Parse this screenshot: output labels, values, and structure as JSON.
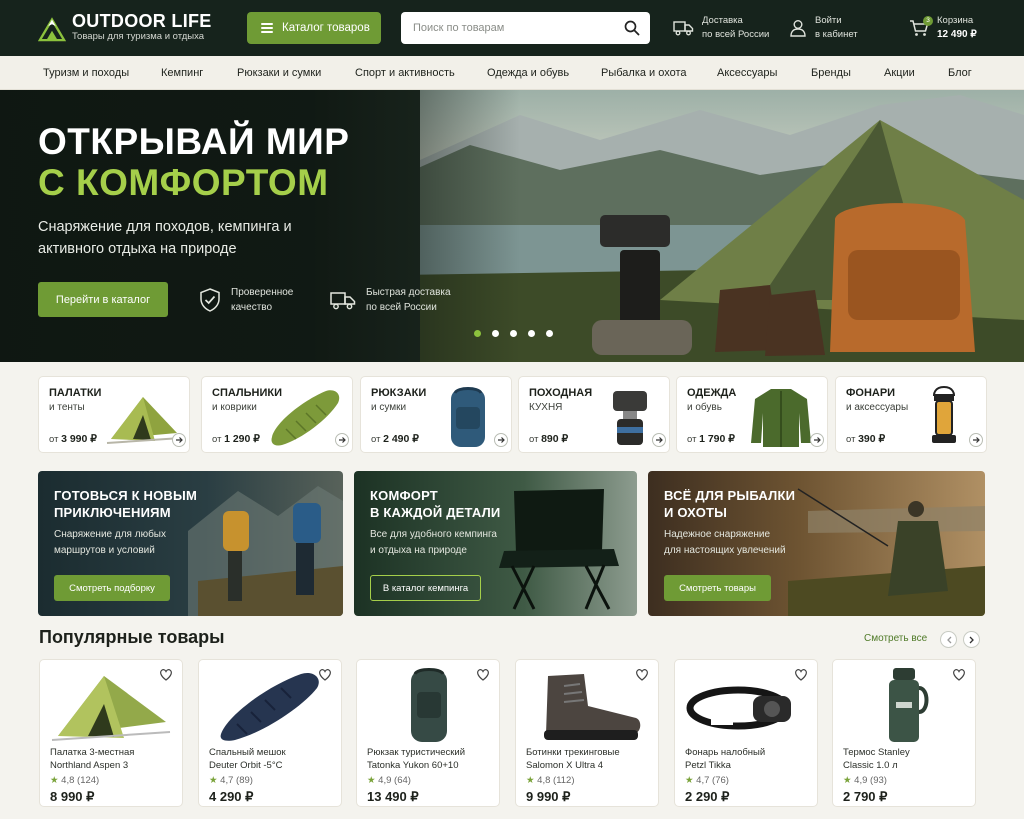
{
  "header": {
    "logo_title": "OUTDOOR LIFE",
    "logo_sub": "Товары для туризма и отдыха",
    "catalog_button": "Каталог товаров",
    "search_placeholder": "Поиск по товарам",
    "delivery_line1": "Доставка",
    "delivery_line2": "по всей России",
    "login_line1": "Войти",
    "login_line2": "в кабинет",
    "cart_label": "Корзина",
    "cart_total": "12 490 ₽",
    "cart_count": "3"
  },
  "nav": [
    {
      "label": "Туризм и походы"
    },
    {
      "label": "Кемпинг"
    },
    {
      "label": "Рюкзаки и сумки"
    },
    {
      "label": "Спорт и активность"
    },
    {
      "label": "Одежда и обувь"
    },
    {
      "label": "Рыбалка и охота"
    },
    {
      "label": "Аксессуары"
    },
    {
      "label": "Бренды"
    },
    {
      "label": "Акции"
    },
    {
      "label": "Блог"
    }
  ],
  "hero": {
    "title_line1": "ОТКРЫВАЙ МИР",
    "title_line2": "С КОМФОРТОМ",
    "subtitle": "Снаряжение для походов, кемпинга и активного отдыха на природе",
    "cta": "Перейти в каталог",
    "feature1": "Проверенное качество",
    "feature2": "Быстрая доставка по всей России",
    "slides_total": 5,
    "slide_active": 1
  },
  "categories": [
    {
      "title": "ПАЛАТКИ",
      "sub": "и тенты",
      "price_prefix": "от",
      "price": "3 990 ₽",
      "icon": "tent-icon"
    },
    {
      "title": "СПАЛЬНИКИ",
      "sub": "и коврики",
      "price_prefix": "от",
      "price": "1 290 ₽",
      "icon": "sleeping-bag-icon"
    },
    {
      "title": "РЮКЗАКИ",
      "sub": "и сумки",
      "price_prefix": "от",
      "price": "2 490 ₽",
      "icon": "backpack-icon"
    },
    {
      "title": "ПОХОДНАЯ",
      "sub": "КУХНЯ",
      "price_prefix": "от",
      "price": "890 ₽",
      "icon": "camp-stove-icon"
    },
    {
      "title": "ОДЕЖДА",
      "sub": "и обувь",
      "price_prefix": "от",
      "price": "1 790 ₽",
      "icon": "jacket-icon"
    },
    {
      "title": "ФОНАРИ",
      "sub": "и аксессуары",
      "price_prefix": "от",
      "price": "390 ₽",
      "icon": "lantern-icon"
    }
  ],
  "promos": [
    {
      "title_line1": "ГОТОВЬСЯ К НОВЫМ",
      "title_line2": "ПРИКЛЮЧЕНИЯМ",
      "text_line1": "Снаряжение для любых",
      "text_line2": "маршрутов и условий",
      "button": "Смотреть подборку"
    },
    {
      "title_line1": "КОМФОРТ",
      "title_line2": "В КАЖДОЙ ДЕТАЛИ",
      "text_line1": "Все для удобного кемпинга",
      "text_line2": "и отдыха на природе",
      "button": "В каталог кемпинга"
    },
    {
      "title_line1": "ВСЁ ДЛЯ РЫБАЛКИ",
      "title_line2": "И ОХОТЫ",
      "text_line1": "Надежное снаряжение",
      "text_line2": "для настоящих увлечений",
      "button": "Смотреть товары"
    }
  ],
  "popular": {
    "title": "Популярные товары",
    "see_all": "Смотреть все",
    "items": [
      {
        "name_line1": "Палатка 3-местная",
        "name_line2": "Northland Aspen 3",
        "rating": "4,8",
        "reviews": "(124)",
        "price": "8 990 ₽",
        "icon": "tent-icon"
      },
      {
        "name_line1": "Спальный мешок",
        "name_line2": "Deuter Orbit -5°C",
        "rating": "4,7",
        "reviews": "(89)",
        "price": "4 290 ₽",
        "icon": "sleeping-bag-icon"
      },
      {
        "name_line1": "Рюкзак туристический",
        "name_line2": "Tatonka Yukon 60+10",
        "rating": "4,9",
        "reviews": "(64)",
        "price": "13 490 ₽",
        "icon": "backpack-icon"
      },
      {
        "name_line1": "Ботинки трекинговые",
        "name_line2": "Salomon X Ultra 4",
        "rating": "4,8",
        "reviews": "(112)",
        "price": "9 990 ₽",
        "icon": "boot-icon"
      },
      {
        "name_line1": "Фонарь налобный",
        "name_line2": "Petzl Tikka",
        "rating": "4,7",
        "reviews": "(76)",
        "price": "2 290 ₽",
        "icon": "headlamp-icon"
      },
      {
        "name_line1": "Термос Stanley",
        "name_line2": "Classic 1.0 л",
        "rating": "4,9",
        "reviews": "(93)",
        "price": "2 790 ₽",
        "icon": "thermos-icon"
      }
    ]
  },
  "colors": {
    "accent": "#6f9b35",
    "header_bg": "#16231c",
    "headline_green": "#a5cf4a"
  }
}
